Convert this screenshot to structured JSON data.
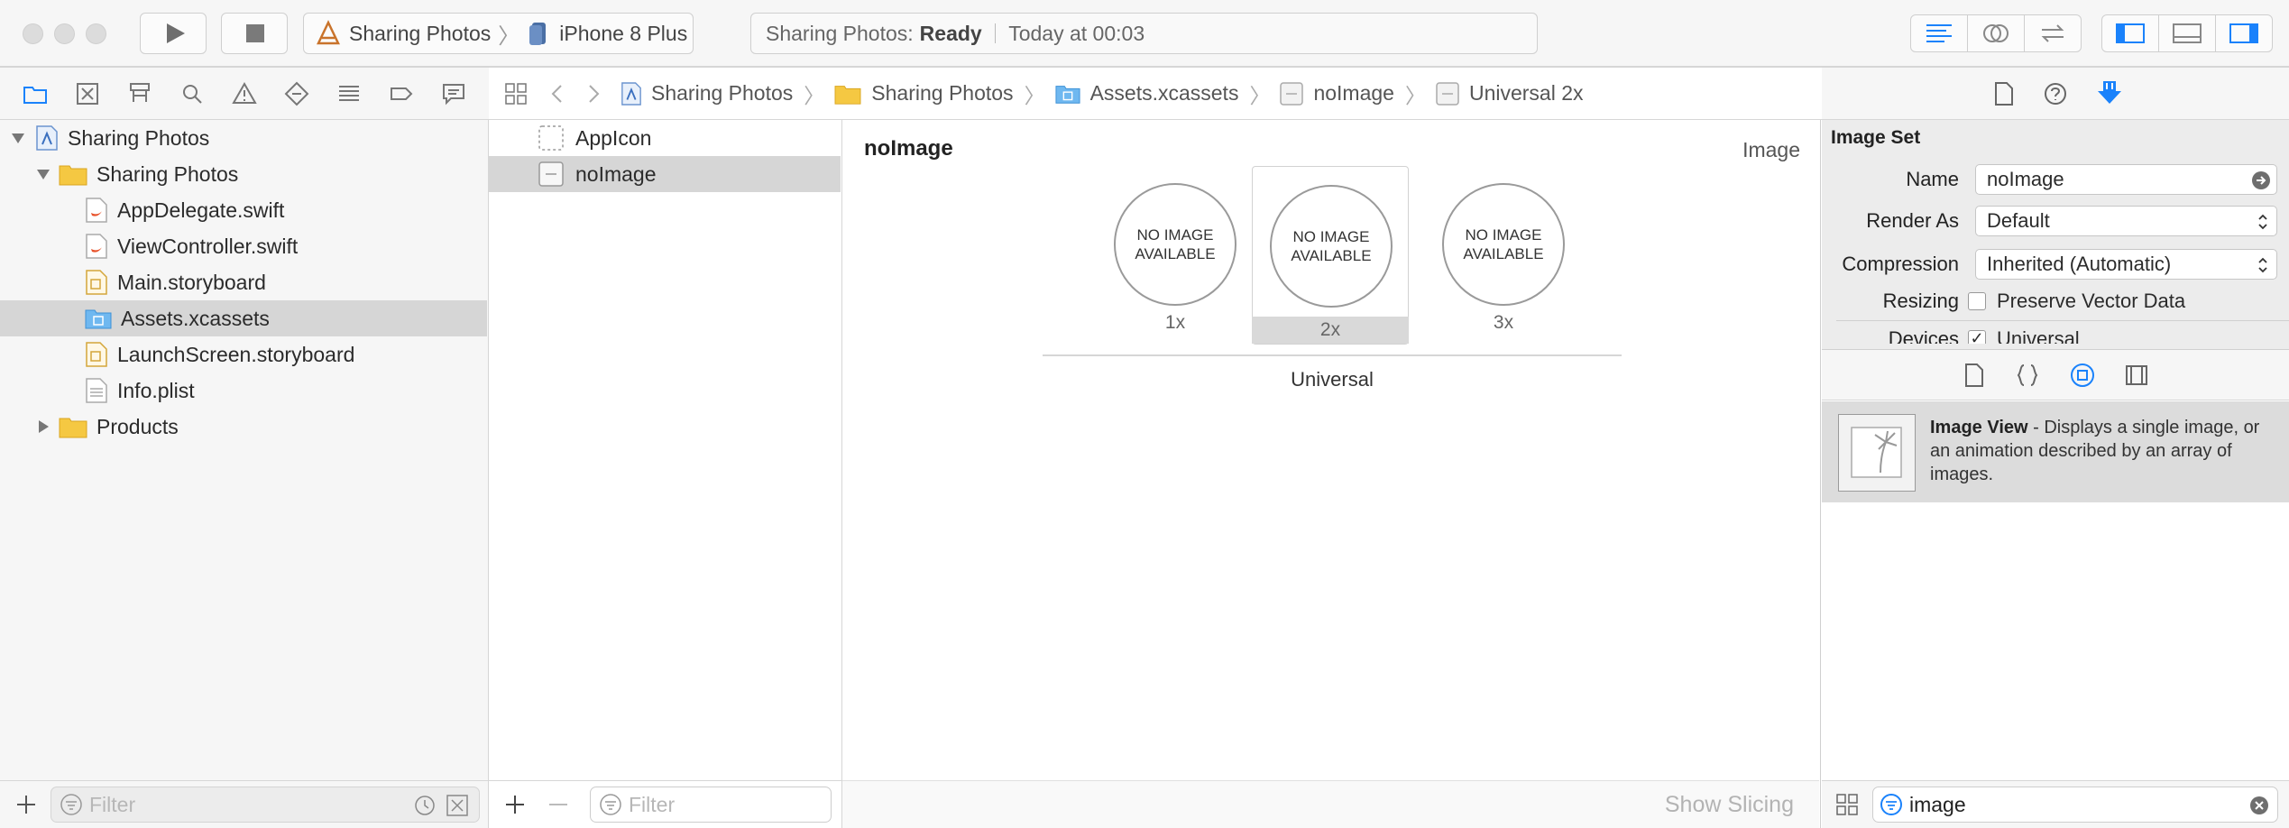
{
  "toolbar": {
    "scheme": "Sharing Photos",
    "device": "iPhone 8 Plus",
    "status_app": "Sharing Photos:",
    "status_state": "Ready",
    "status_time": "Today at 00:03"
  },
  "navigator": {
    "project": "Sharing Photos",
    "group": "Sharing Photos",
    "files": [
      {
        "label": "AppDelegate.swift",
        "icon": "swift-file-icon"
      },
      {
        "label": "ViewController.swift",
        "icon": "swift-file-icon"
      },
      {
        "label": "Main.storyboard",
        "icon": "storyboard-file-icon"
      },
      {
        "label": "Assets.xcassets",
        "icon": "asset-catalog-icon"
      },
      {
        "label": "LaunchScreen.storyboard",
        "icon": "storyboard-file-icon"
      },
      {
        "label": "Info.plist",
        "icon": "plist-file-icon"
      }
    ],
    "products": "Products",
    "filter_placeholder": "Filter"
  },
  "jumpbar": {
    "crumbs": [
      "Sharing Photos",
      "Sharing Photos",
      "Assets.xcassets",
      "noImage",
      "Universal 2x"
    ]
  },
  "assets": {
    "items": [
      "AppIcon",
      "noImage"
    ],
    "filter_placeholder": "Filter"
  },
  "editor": {
    "title": "noImage",
    "kind": "Image",
    "placeholder_line1": "NO IMAGE",
    "placeholder_line2": "AVAILABLE",
    "scales": [
      "1x",
      "2x",
      "3x"
    ],
    "group_label": "Universal",
    "show_slicing": "Show Slicing"
  },
  "inspector": {
    "section": "Image Set",
    "name_label": "Name",
    "name_value": "noImage",
    "render_label": "Render As",
    "render_value": "Default",
    "compression_label": "Compression",
    "compression_value": "Inherited (Automatic)",
    "resizing_label": "Resizing",
    "resizing_value": "Preserve Vector Data",
    "devices_label": "Devices",
    "devices_value": "Universal",
    "library_title": "Image View",
    "library_desc": " - Displays a single image, or an animation described by an array of images.",
    "library_filter": "image"
  },
  "colors": {
    "accent": "#1a82fb",
    "folder": "#f5c842",
    "selection": "#d6d6d6"
  }
}
